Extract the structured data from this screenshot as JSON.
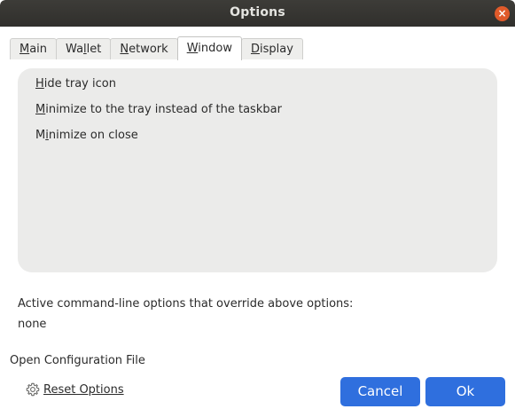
{
  "window": {
    "title": "Options",
    "close_glyph": "×"
  },
  "tabs": [
    {
      "label": "Main",
      "accel": "M",
      "rest": "ain"
    },
    {
      "label": "Wallet",
      "pre": "Wa",
      "accel": "l",
      "rest": "let"
    },
    {
      "label": "Network",
      "accel": "N",
      "rest": "etwork"
    },
    {
      "label": "Window",
      "accel": "W",
      "rest": "indow",
      "active": true
    },
    {
      "label": "Display",
      "accel": "D",
      "rest": "isplay"
    }
  ],
  "options": [
    {
      "accel": "H",
      "rest": "ide tray icon"
    },
    {
      "accel": "M",
      "rest": "inimize to the tray instead of the taskbar"
    },
    {
      "pre": "M",
      "accel": "i",
      "rest": "nimize on close"
    }
  ],
  "cmdline": {
    "label": "Active command-line options that override above options:",
    "value": "none"
  },
  "footer": {
    "open_config": "Open Configuration File",
    "reset_label": "Reset Options",
    "cancel_label": "Cancel",
    "ok_label": "Ok"
  },
  "icons": {
    "reset": "gear-icon",
    "close": "close-icon"
  },
  "colors": {
    "accent": "#2f6fde",
    "titlebar": "#302f2c",
    "close": "#e05a2a",
    "panel": "#ebebea"
  }
}
